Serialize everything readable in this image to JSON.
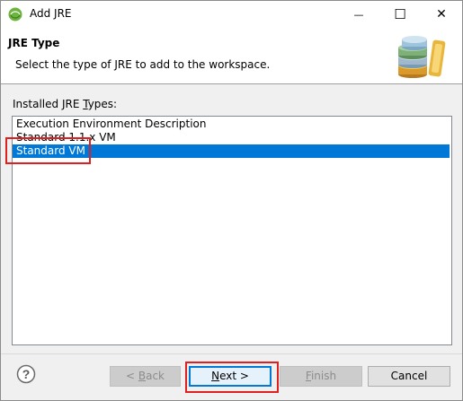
{
  "window": {
    "title": "Add JRE",
    "minimize_glyph": "—",
    "maximize_glyph": "☐",
    "close_glyph": "✕"
  },
  "header": {
    "title": "JRE Type",
    "description": "Select the type of JRE to add to the workspace."
  },
  "list": {
    "label_prefix": "Installed JRE ",
    "label_mnemonic": "T",
    "label_suffix": "ypes:",
    "items": [
      "Execution Environment Description",
      "Standard 1.1.x VM",
      "Standard VM"
    ],
    "selected_index": 2
  },
  "buttons": {
    "back_prefix": "< ",
    "back_mnemonic": "B",
    "back_suffix": "ack",
    "next_mnemonic": "N",
    "next_suffix": "ext >",
    "finish_mnemonic": "F",
    "finish_suffix": "inish",
    "cancel": "Cancel",
    "help_glyph": "?"
  },
  "colors": {
    "selection": "#0078d7",
    "annotation": "#e02020"
  }
}
